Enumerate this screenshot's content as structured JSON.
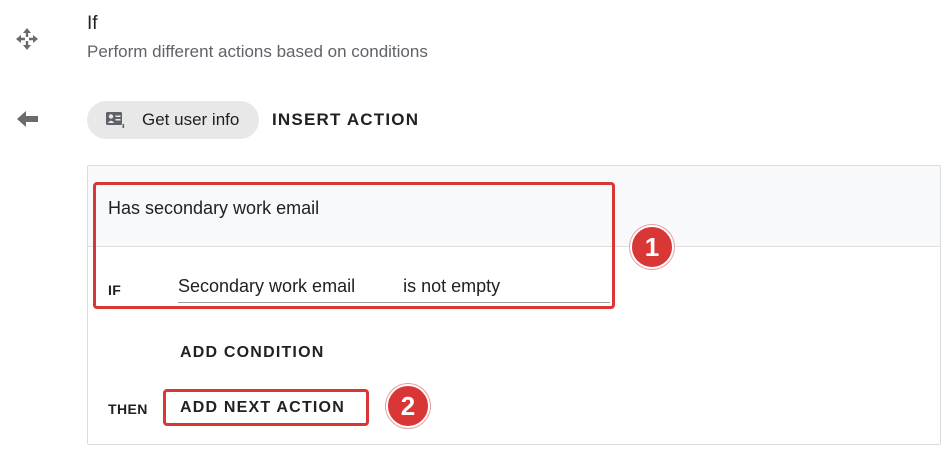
{
  "header": {
    "title": "If",
    "subtitle": "Perform different actions based on conditions"
  },
  "action_bar": {
    "chip_label": "Get user info",
    "insert_action_label": "INSERT ACTION"
  },
  "condition": {
    "name": "Has secondary work email",
    "if_label": "IF",
    "field_name": "Secondary work email",
    "operator": "is not empty",
    "add_condition_label": "ADD CONDITION",
    "then_label": "THEN",
    "add_next_action_label": "ADD NEXT ACTION"
  },
  "annotations": {
    "marker_1": "1",
    "marker_2": "2",
    "color": "#d93636"
  },
  "icons": {
    "branch": "branch-arrows-icon",
    "back": "arrow-left-icon",
    "chip": "contact-card-icon"
  }
}
